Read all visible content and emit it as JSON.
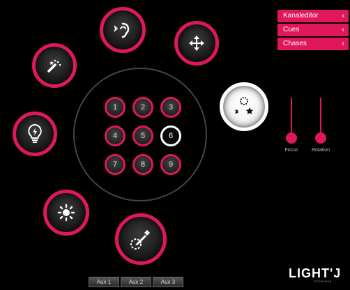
{
  "menu": {
    "items": [
      {
        "label": "Kanaleditor",
        "chevron": "‹"
      },
      {
        "label": "Cues",
        "chevron": "‹"
      },
      {
        "label": "Chases",
        "chevron": "‹"
      }
    ]
  },
  "tool_buttons": [
    {
      "icon": "sound-ear-icon"
    },
    {
      "icon": "move-arrows-icon"
    },
    {
      "icon": "magic-wand-icon"
    },
    {
      "icon": "lightbulb-icon"
    },
    {
      "icon": "brightness-sun-icon"
    },
    {
      "icon": "color-picker-icon"
    },
    {
      "icon": "gobo-effects-icon",
      "active": true
    }
  ],
  "channels": [
    "1",
    "2",
    "3",
    "4",
    "5",
    "6",
    "7",
    "8",
    "9"
  ],
  "selected_channel": "6",
  "sliders": {
    "focus": {
      "label": "Focus",
      "value": 0.0
    },
    "rotation": {
      "label": "Rotation",
      "value": 0.0
    }
  },
  "aux": [
    "Aux 1",
    "Aux 2",
    "Aux 3"
  ],
  "logo": {
    "main": "LIGHT'J",
    "sub": "STEINIGKE"
  },
  "colors": {
    "accent": "#e0185a",
    "background": "#000000"
  }
}
